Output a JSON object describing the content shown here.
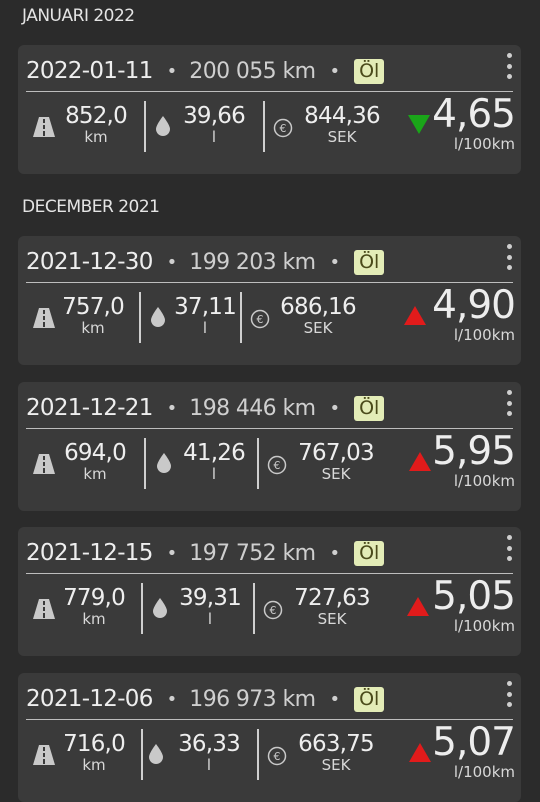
{
  "sections": [
    {
      "title": "JANUARI 2022"
    },
    {
      "title": "DECEMBER 2021"
    }
  ],
  "entries": [
    {
      "date": "2022-01-11",
      "odometer": "200 055 km",
      "tag": "Öl",
      "distance": "852,0",
      "distance_unit": "km",
      "volume": "39,66",
      "volume_unit": "l",
      "cost": "844,36",
      "cost_unit": "SEK",
      "consumption": "4,65",
      "consumption_unit": "l/100km",
      "trend": "down"
    },
    {
      "date": "2021-12-30",
      "odometer": "199 203 km",
      "tag": "Öl",
      "distance": "757,0",
      "distance_unit": "km",
      "volume": "37,11",
      "volume_unit": "l",
      "cost": "686,16",
      "cost_unit": "SEK",
      "consumption": "4,90",
      "consumption_unit": "l/100km",
      "trend": "up"
    },
    {
      "date": "2021-12-21",
      "odometer": "198 446 km",
      "tag": "Öl",
      "distance": "694,0",
      "distance_unit": "km",
      "volume": "41,26",
      "volume_unit": "l",
      "cost": "767,03",
      "cost_unit": "SEK",
      "consumption": "5,95",
      "consumption_unit": "l/100km",
      "trend": "up"
    },
    {
      "date": "2021-12-15",
      "odometer": "197 752 km",
      "tag": "Öl",
      "distance": "779,0",
      "distance_unit": "km",
      "volume": "39,31",
      "volume_unit": "l",
      "cost": "727,63",
      "cost_unit": "SEK",
      "consumption": "5,05",
      "consumption_unit": "l/100km",
      "trend": "up"
    },
    {
      "date": "2021-12-06",
      "odometer": "196 973 km",
      "tag": "Öl",
      "distance": "716,0",
      "distance_unit": "km",
      "volume": "36,33",
      "volume_unit": "l",
      "cost": "663,75",
      "cost_unit": "SEK",
      "consumption": "5,07",
      "consumption_unit": "l/100km",
      "trend": "up"
    }
  ],
  "colors": {
    "background": "#2b2b2b",
    "card": "#3a3a3a",
    "tag": "#e3ecb7",
    "trend_up": "#e11b1b",
    "trend_down": "#1aa519"
  },
  "icons": {
    "distance": "road-icon",
    "volume": "fuel-drop-icon",
    "cost": "euro-coin-icon",
    "menu": "more-vertical-icon"
  }
}
